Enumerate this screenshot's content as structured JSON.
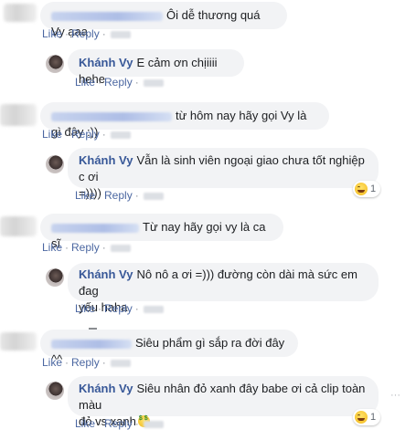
{
  "actions": {
    "like": "Like",
    "reply": "Reply",
    "separator": "·"
  },
  "comments": [
    {
      "text": "Ôi dễ thương quá Vy ạaa"
    },
    {
      "author": "Khánh Vy",
      "text": "E cảm ơn chịiiii hehe"
    },
    {
      "text": "từ hôm nay hãy gọi Vy là gì đây :))"
    },
    {
      "author": "Khánh Vy",
      "text_line1": "Vẫn là sinh viên ngoại giao chưa tốt nghiệp c ơi",
      "text_line2": "=))))",
      "reaction_count": "1"
    },
    {
      "text": "Từ nay hãy gọi vy là ca sĩ"
    },
    {
      "author": "Khánh Vy",
      "text_line1": "Nô nô a ơi =))) đường còn dài mà sức em đag",
      "text_line2": "yếu haha"
    },
    {
      "text": "Siêu phẩm gì sắp ra đời đây ^^"
    },
    {
      "author": "Khánh Vy",
      "text_line1": "Siêu nhân đỏ xanh đây babe ơi cả clip toàn màu",
      "text_line2": "đỏ vs xanh",
      "reaction_count": "1"
    }
  ],
  "icons": {
    "reaction": "laughing-face-icon",
    "emoji": "money-mouth-face-icon",
    "options": "more-options-icon"
  },
  "more_options_glyph": "···"
}
